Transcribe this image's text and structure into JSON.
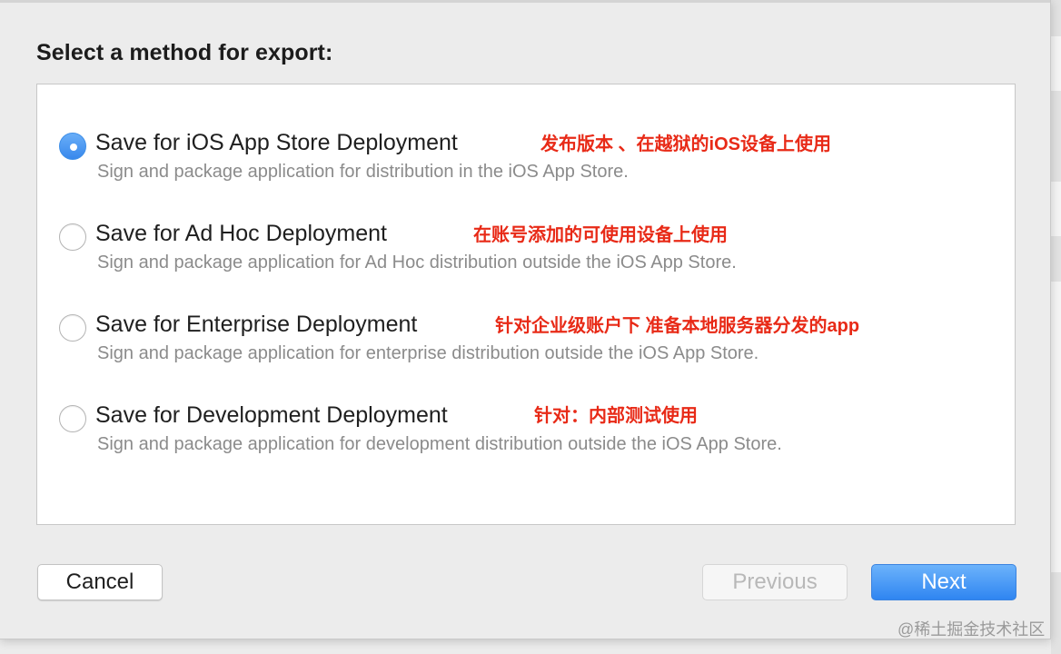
{
  "dialog": {
    "heading": "Select a method for export:",
    "options": [
      {
        "title": "Save for iOS App Store Deployment",
        "description": "Sign and package application for distribution in the iOS App Store.",
        "note": "发布版本 、在越狱的iOS设备上使用",
        "selected": true
      },
      {
        "title": "Save for Ad Hoc Deployment",
        "description": "Sign and package application for Ad Hoc distribution outside the iOS App Store.",
        "note": "在账号添加的可使用设备上使用",
        "selected": false
      },
      {
        "title": "Save for Enterprise Deployment",
        "description": "Sign and package application for enterprise distribution outside the iOS App Store.",
        "note": "针对企业级账户下 准备本地服务器分发的app",
        "selected": false
      },
      {
        "title": "Save for Development Deployment",
        "description": "Sign and package application for development distribution outside the iOS App Store.",
        "note": "针对：内部测试使用",
        "selected": false
      }
    ],
    "buttons": {
      "cancel": "Cancel",
      "previous": "Previous",
      "next": "Next"
    }
  },
  "watermark": "@稀土掘金技术社区",
  "colors": {
    "accent": "#3888ec",
    "annotation": "#e82a17",
    "background": "#ececec"
  }
}
